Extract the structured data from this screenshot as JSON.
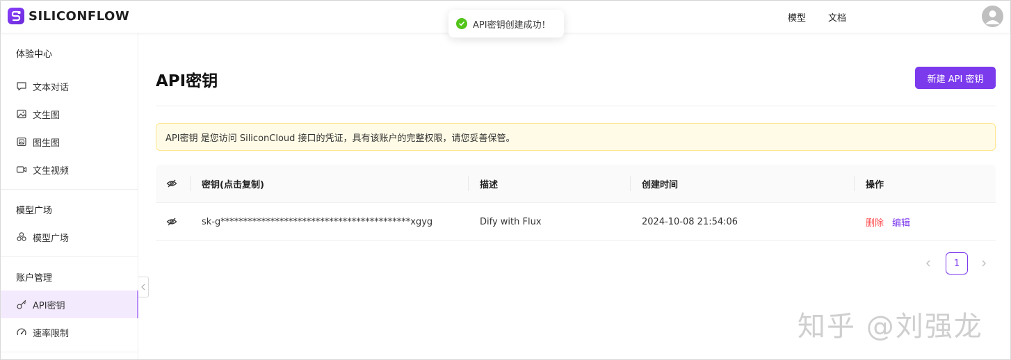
{
  "app": {
    "brand": "SILICONFLOW",
    "brand_color": "#7c3aed"
  },
  "header": {
    "nav": [
      "模型",
      "文档"
    ]
  },
  "toast": {
    "message": "API密钥创建成功！",
    "type": "success"
  },
  "sidebar": {
    "groups": [
      {
        "title": "体验中心",
        "items": [
          {
            "label": "文本对话",
            "icon": "chat-icon"
          },
          {
            "label": "文生图",
            "icon": "image-icon"
          },
          {
            "label": "图生图",
            "icon": "image-edit-icon"
          },
          {
            "label": "文生视频",
            "icon": "video-icon"
          }
        ]
      },
      {
        "title": "模型广场",
        "items": [
          {
            "label": "模型广场",
            "icon": "models-icon"
          }
        ]
      },
      {
        "title": "账户管理",
        "items": [
          {
            "label": "API密钥",
            "icon": "key-icon",
            "active": true
          },
          {
            "label": "速率限制",
            "icon": "gauge-icon"
          }
        ]
      }
    ]
  },
  "main": {
    "title": "API密钥",
    "new_key_button": "新建 API 密钥",
    "alert": "API密钥 是您访问 SiliconCloud 接口的凭证，具有该账户的完整权限，请您妥善保管。",
    "table": {
      "columns": [
        "密钥(点击复制)",
        "描述",
        "创建时间",
        "操作"
      ],
      "rows": [
        {
          "key": "sk-g******************************************xgyg",
          "description": "Dify with Flux",
          "created": "2024-10-08 21:54:06",
          "actions": [
            "删除",
            "编辑"
          ]
        }
      ]
    },
    "pagination": {
      "current": "1"
    }
  },
  "watermark": "知乎 @刘强龙"
}
